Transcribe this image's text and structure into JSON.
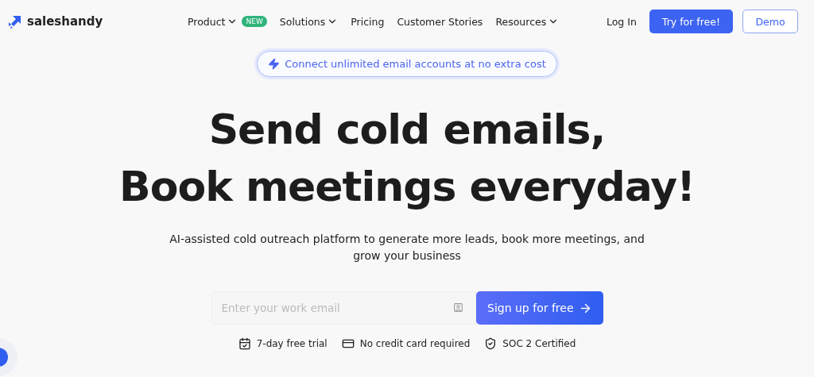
{
  "logo": {
    "text": "saleshandy"
  },
  "nav": [
    {
      "label": "Product",
      "dropdown": true,
      "badge": "NEW"
    },
    {
      "label": "Solutions",
      "dropdown": true
    },
    {
      "label": "Pricing",
      "dropdown": false
    },
    {
      "label": "Customer Stories",
      "dropdown": false
    },
    {
      "label": "Resources",
      "dropdown": true
    }
  ],
  "actions": {
    "login": "Log In",
    "try": "Try for free!",
    "demo": "Demo"
  },
  "banner": {
    "text": "Connect unlimited email accounts at no extra cost"
  },
  "headline": [
    "Send cold emails,",
    "Book meetings everyday!"
  ],
  "subtitle": "AI-assisted cold outreach platform to generate more leads, book more meetings, and grow your business",
  "signup": {
    "placeholder": "Enter your work email",
    "button": "Sign up for free"
  },
  "features": [
    {
      "kind": "calendar",
      "label": "7-day free trial"
    },
    {
      "kind": "card",
      "label": "No credit card required"
    },
    {
      "kind": "shield",
      "label": "SOC 2 Certified"
    }
  ]
}
